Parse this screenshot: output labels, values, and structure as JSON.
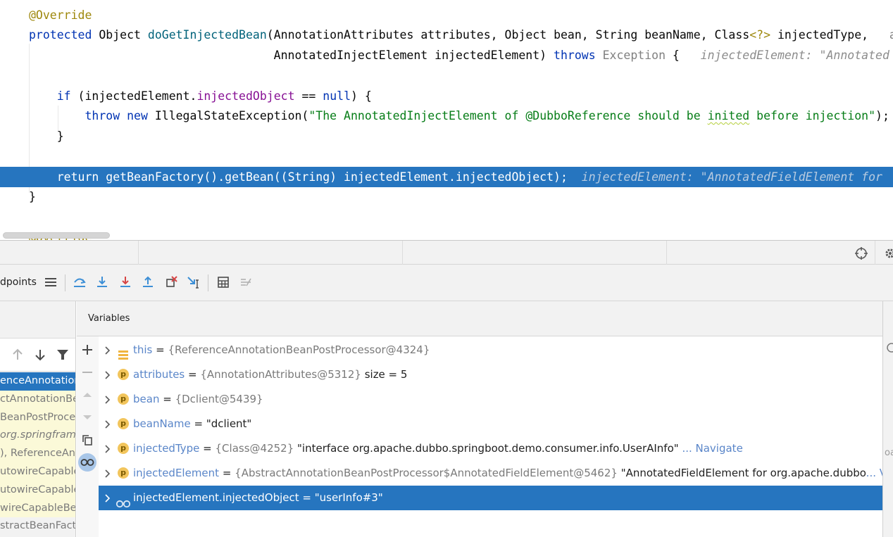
{
  "editor": {
    "lines": [
      [
        {
          "c": "tk-ann",
          "t": "@Override"
        }
      ],
      [
        {
          "c": "tk-kw",
          "t": "protected"
        },
        {
          "t": " Object "
        },
        {
          "c": "tk-fn",
          "t": "doGetInjectedBean"
        },
        {
          "t": "(AnnotationAttributes attributes, Object bean, String beanName, Class"
        },
        {
          "c": "tk-gen",
          "t": "<?>"
        },
        {
          "t": " injectedType,   "
        },
        {
          "c": "tk-gray",
          "t": "a"
        }
      ],
      [
        {
          "t": "                                   AnnotatedInjectElement injectedElement) "
        },
        {
          "c": "tk-kw",
          "t": "throws"
        },
        {
          "t": " "
        },
        {
          "c": "tk-ph",
          "t": "Exception"
        },
        {
          "t": " {   "
        },
        {
          "c": "inlay",
          "t": "injectedElement: \"Annotated"
        }
      ],
      [],
      [
        {
          "t": "    "
        },
        {
          "c": "tk-kw",
          "t": "if"
        },
        {
          "t": " (injectedElement."
        },
        {
          "c": "tk-fld",
          "t": "injectedObject"
        },
        {
          "t": " == "
        },
        {
          "c": "tk-kw",
          "t": "null"
        },
        {
          "t": ") {"
        }
      ],
      [
        {
          "t": "        "
        },
        {
          "c": "tk-kw",
          "t": "throw new"
        },
        {
          "t": " IllegalStateException("
        },
        {
          "c": "tk-str",
          "t": "\"The AnnotatedInjectElement of @DubboReference should be "
        },
        {
          "c": "tk-str squig",
          "t": "inited"
        },
        {
          "c": "tk-str",
          "t": " before injection\""
        },
        {
          "t": ");"
        }
      ],
      [
        {
          "t": "    }"
        }
      ],
      [],
      [
        {
          "t": "    "
        },
        {
          "t": "return getBeanFactory().getBean((String) injectedElement.injectedObject);  "
        },
        {
          "c": "inlay",
          "t": "injectedElement: \"AnnotatedFieldElement for"
        }
      ],
      [
        {
          "t": "}"
        }
      ],
      [],
      [
        {
          "c": "tk-ann",
          "t": "@Override"
        }
      ]
    ]
  },
  "toolbar": {
    "breakpoints_label": "dpoints",
    "icons": [
      "layout-icon",
      "step-over-icon",
      "step-into-icon",
      "force-step-into-icon",
      "step-out-icon",
      "drop-frame-icon",
      "run-to-cursor-icon",
      "evaluate-expression-icon",
      "trace-icon"
    ]
  },
  "frames": [
    "enceAnnotation",
    "ctAnnotationBea",
    "BeanPostProces",
    "org.springframe",
    "), ReferenceAnn",
    "utowireCapable",
    "utowireCapableB",
    "wireCapableBea",
    "stractBeanFacto"
  ],
  "variables": {
    "title": "Variables",
    "rows": [
      {
        "icon": "field-icon",
        "name": "this",
        "eq": " = ",
        "type": "{ReferenceAnnotationBeanPostProcessor@4324}",
        "value": "",
        "link": ""
      },
      {
        "icon": "p",
        "name": "attributes",
        "eq": " = ",
        "type": "{AnnotationAttributes@5312}",
        "value": "  size = 5",
        "link": ""
      },
      {
        "icon": "p",
        "name": "bean",
        "eq": " = ",
        "type": "{Dclient@5439}",
        "value": "",
        "link": ""
      },
      {
        "icon": "p",
        "name": "beanName",
        "eq": " = ",
        "type": "",
        "value": "\"dclient\"",
        "link": ""
      },
      {
        "icon": "p",
        "name": "injectedType",
        "eq": " = ",
        "type": "{Class@4252}",
        "value": " \"interface org.apache.dubbo.springboot.demo.consumer.info.UserAInfo\"",
        "link": " ... Navigate"
      },
      {
        "icon": "p",
        "name": "injectedElement",
        "eq": " = ",
        "type": "{AbstractAnnotationBeanPostProcessor$AnnotatedFieldElement@5462}",
        "value": " \"AnnotatedFieldElement for org.apache.dubbo",
        "link": "... View"
      },
      {
        "icon": "watch",
        "name": "injectedElement.injectedObject",
        "eq": " = ",
        "type": "",
        "value": "\"userInfo#3\"",
        "link": ""
      }
    ]
  },
  "right_strip": {
    "text": "oa"
  },
  "colors": {
    "selection": "#2675bf",
    "keyword": "#0033b3",
    "string": "#067d17",
    "annotation": "#9e880d"
  }
}
